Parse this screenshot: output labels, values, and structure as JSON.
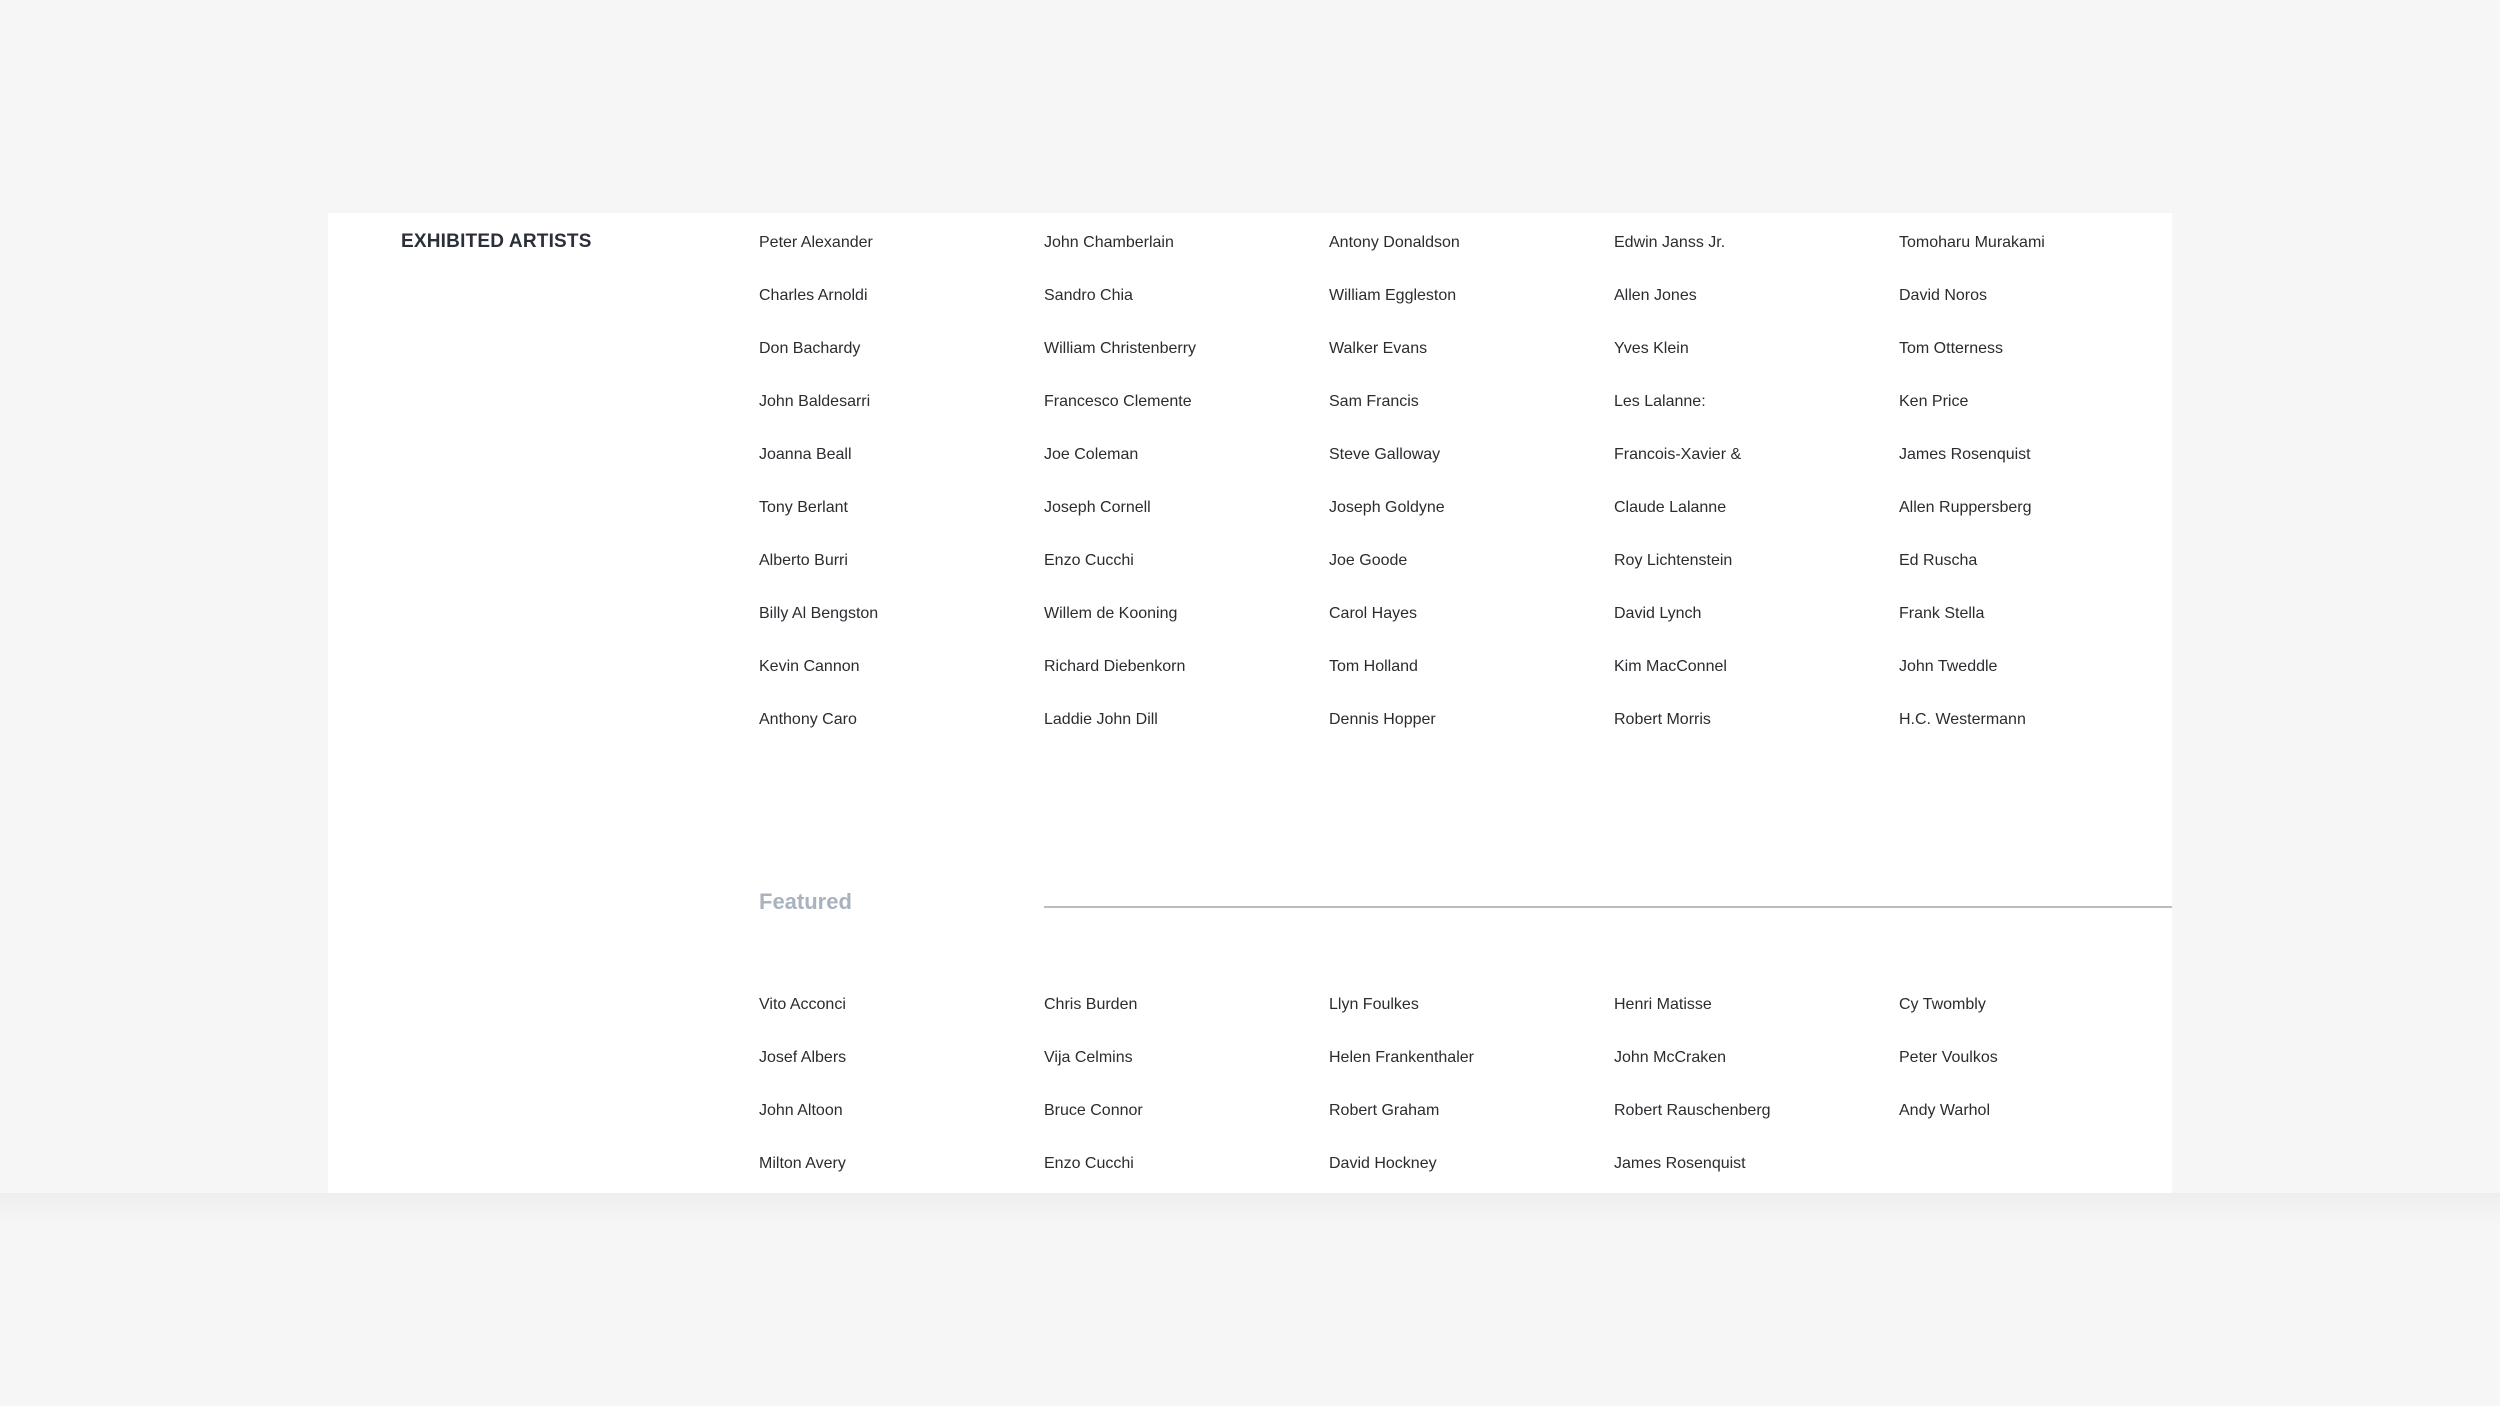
{
  "exhibited": {
    "title": "EXHIBITED ARTISTS",
    "columns": [
      [
        "Peter Alexander",
        "Charles Arnoldi",
        "Don Bachardy",
        "John Baldesarri",
        "Joanna Beall",
        "Tony Berlant",
        "Alberto Burri",
        "Billy Al Bengston",
        "Kevin Cannon",
        "Anthony Caro"
      ],
      [
        "John Chamberlain",
        "Sandro Chia",
        "William Christenberry",
        "Francesco Clemente",
        "Joe Coleman",
        "Joseph Cornell",
        "Enzo Cucchi",
        "Willem de Kooning",
        "Richard Diebenkorn",
        "Laddie John Dill"
      ],
      [
        "Antony Donaldson",
        "William Eggleston",
        "Walker Evans",
        "Sam Francis",
        "Steve Galloway",
        "Joseph Goldyne",
        "Joe Goode",
        "Carol Hayes",
        "Tom Holland",
        "Dennis Hopper"
      ],
      [
        "Edwin Janss Jr.",
        "Allen Jones",
        "Yves Klein",
        "Les Lalanne:",
        "Francois-Xavier &",
        "Claude Lalanne",
        "Roy Lichtenstein",
        "David Lynch",
        "Kim MacConnel",
        "Robert Morris"
      ],
      [
        "Tomoharu Murakami",
        "David Noros",
        "Tom Otterness",
        "Ken Price",
        "James Rosenquist",
        "Allen Ruppersberg",
        "Ed Ruscha",
        "Frank Stella",
        "John Tweddle",
        "H.C. Westermann"
      ]
    ]
  },
  "featured": {
    "title": "Featured",
    "columns": [
      [
        "Vito Acconci",
        "Josef Albers",
        "John Altoon",
        "Milton Avery"
      ],
      [
        "Chris Burden",
        "Vija Celmins",
        "Bruce Connor",
        "Enzo Cucchi"
      ],
      [
        "Llyn Foulkes",
        "Helen Frankenthaler",
        "Robert Graham",
        "David Hockney"
      ],
      [
        "Henri Matisse",
        "John McCraken",
        "Robert Rauschenberg",
        "James Rosenquist"
      ],
      [
        "Cy Twombly",
        "Peter Voulkos",
        "Andy Warhol"
      ]
    ]
  }
}
